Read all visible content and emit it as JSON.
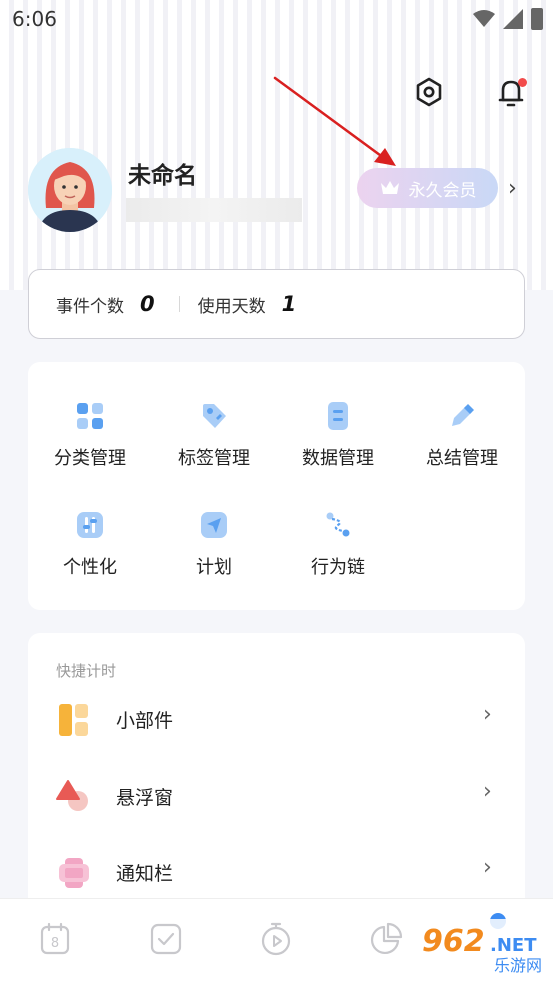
{
  "status_bar": {
    "time": "6:06"
  },
  "header": {
    "settings_icon": "gear-icon",
    "bell_icon": "bell-icon",
    "bell_has_badge": true
  },
  "profile": {
    "name": "未命名",
    "vip_label": "永久会员"
  },
  "stats": {
    "events_label": "事件个数",
    "events_value": "0",
    "days_label": "使用天数",
    "days_value": "1"
  },
  "grid": [
    {
      "label": "分类管理",
      "icon": "category-icon"
    },
    {
      "label": "标签管理",
      "icon": "tag-icon"
    },
    {
      "label": "数据管理",
      "icon": "data-icon"
    },
    {
      "label": "总结管理",
      "icon": "pen-icon"
    },
    {
      "label": "个性化",
      "icon": "sliders-icon"
    },
    {
      "label": "计划",
      "icon": "send-icon"
    },
    {
      "label": "行为链",
      "icon": "chain-icon"
    }
  ],
  "quick_timer": {
    "title": "快捷计时",
    "items": [
      {
        "label": "小部件",
        "icon": "widget-icon"
      },
      {
        "label": "悬浮窗",
        "icon": "floating-window-icon"
      },
      {
        "label": "通知栏",
        "icon": "notification-bar-icon"
      }
    ]
  },
  "bottom_nav": [
    {
      "name": "calendar",
      "icon": "calendar-icon",
      "day": "8"
    },
    {
      "name": "tasks",
      "icon": "checkbox-icon"
    },
    {
      "name": "timer",
      "icon": "stopwatch-icon"
    },
    {
      "name": "stats",
      "icon": "pie-chart-icon"
    },
    {
      "name": "profile",
      "icon": "profile-icon",
      "active": true
    }
  ],
  "watermark": {
    "text_top": "962",
    "text_top_suffix": ".NET",
    "text_bottom": "乐游网"
  },
  "colors": {
    "accent": "#3d8cf2",
    "icon_blue": "#5aa0f0",
    "icon_light_blue": "#a9cdf7",
    "badge_red": "#f24b4b",
    "vip_gradient_start": "#ecd3ef",
    "vip_gradient_end": "#c9d8f6",
    "annotation_red": "#d92020"
  }
}
